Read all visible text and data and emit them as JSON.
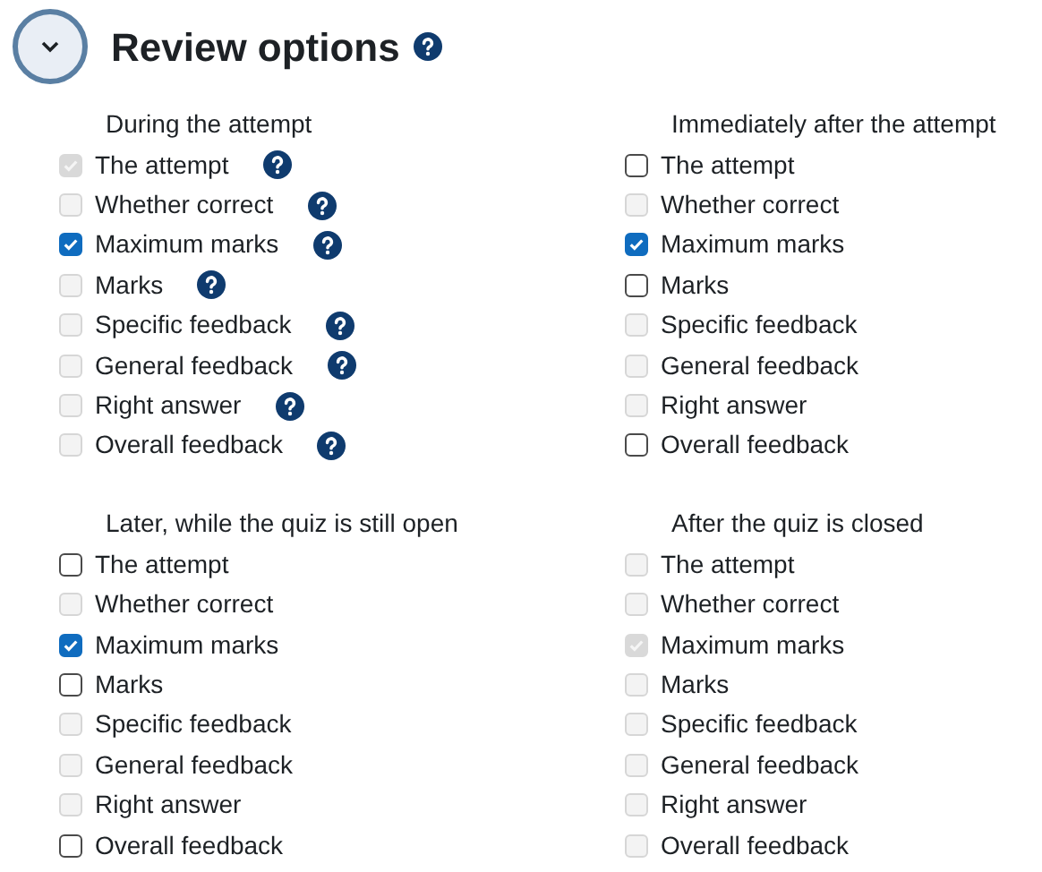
{
  "section": {
    "title": "Review options",
    "expanded": true
  },
  "groups": [
    {
      "heading": "During the attempt",
      "items": [
        {
          "label": "The attempt",
          "checked": true,
          "disabled": true,
          "help": true
        },
        {
          "label": "Whether correct",
          "checked": false,
          "disabled": true,
          "help": true
        },
        {
          "label": "Maximum marks",
          "checked": true,
          "disabled": false,
          "help": true
        },
        {
          "label": "Marks",
          "checked": false,
          "disabled": true,
          "help": true
        },
        {
          "label": "Specific feedback",
          "checked": false,
          "disabled": true,
          "help": true
        },
        {
          "label": "General feedback",
          "checked": false,
          "disabled": true,
          "help": true
        },
        {
          "label": "Right answer",
          "checked": false,
          "disabled": true,
          "help": true
        },
        {
          "label": "Overall feedback",
          "checked": false,
          "disabled": true,
          "help": true
        }
      ]
    },
    {
      "heading": "Immediately after the attempt",
      "items": [
        {
          "label": "The attempt",
          "checked": false,
          "disabled": false,
          "help": false
        },
        {
          "label": "Whether correct",
          "checked": false,
          "disabled": true,
          "help": false
        },
        {
          "label": "Maximum marks",
          "checked": true,
          "disabled": false,
          "help": false
        },
        {
          "label": "Marks",
          "checked": false,
          "disabled": false,
          "help": false
        },
        {
          "label": "Specific feedback",
          "checked": false,
          "disabled": true,
          "help": false
        },
        {
          "label": "General feedback",
          "checked": false,
          "disabled": true,
          "help": false
        },
        {
          "label": "Right answer",
          "checked": false,
          "disabled": true,
          "help": false
        },
        {
          "label": "Overall feedback",
          "checked": false,
          "disabled": false,
          "help": false
        }
      ]
    },
    {
      "heading": "Later, while the quiz is still open",
      "items": [
        {
          "label": "The attempt",
          "checked": false,
          "disabled": false,
          "help": false
        },
        {
          "label": "Whether correct",
          "checked": false,
          "disabled": true,
          "help": false
        },
        {
          "label": "Maximum marks",
          "checked": true,
          "disabled": false,
          "help": false
        },
        {
          "label": "Marks",
          "checked": false,
          "disabled": false,
          "help": false
        },
        {
          "label": "Specific feedback",
          "checked": false,
          "disabled": true,
          "help": false
        },
        {
          "label": "General feedback",
          "checked": false,
          "disabled": true,
          "help": false
        },
        {
          "label": "Right answer",
          "checked": false,
          "disabled": true,
          "help": false
        },
        {
          "label": "Overall feedback",
          "checked": false,
          "disabled": false,
          "help": false
        }
      ]
    },
    {
      "heading": "After the quiz is closed",
      "items": [
        {
          "label": "The attempt",
          "checked": false,
          "disabled": true,
          "help": false
        },
        {
          "label": "Whether correct",
          "checked": false,
          "disabled": true,
          "help": false
        },
        {
          "label": "Maximum marks",
          "checked": true,
          "disabled": true,
          "help": false
        },
        {
          "label": "Marks",
          "checked": false,
          "disabled": true,
          "help": false
        },
        {
          "label": "Specific feedback",
          "checked": false,
          "disabled": true,
          "help": false
        },
        {
          "label": "General feedback",
          "checked": false,
          "disabled": true,
          "help": false
        },
        {
          "label": "Right answer",
          "checked": false,
          "disabled": true,
          "help": false
        },
        {
          "label": "Overall feedback",
          "checked": false,
          "disabled": true,
          "help": false
        }
      ]
    }
  ]
}
